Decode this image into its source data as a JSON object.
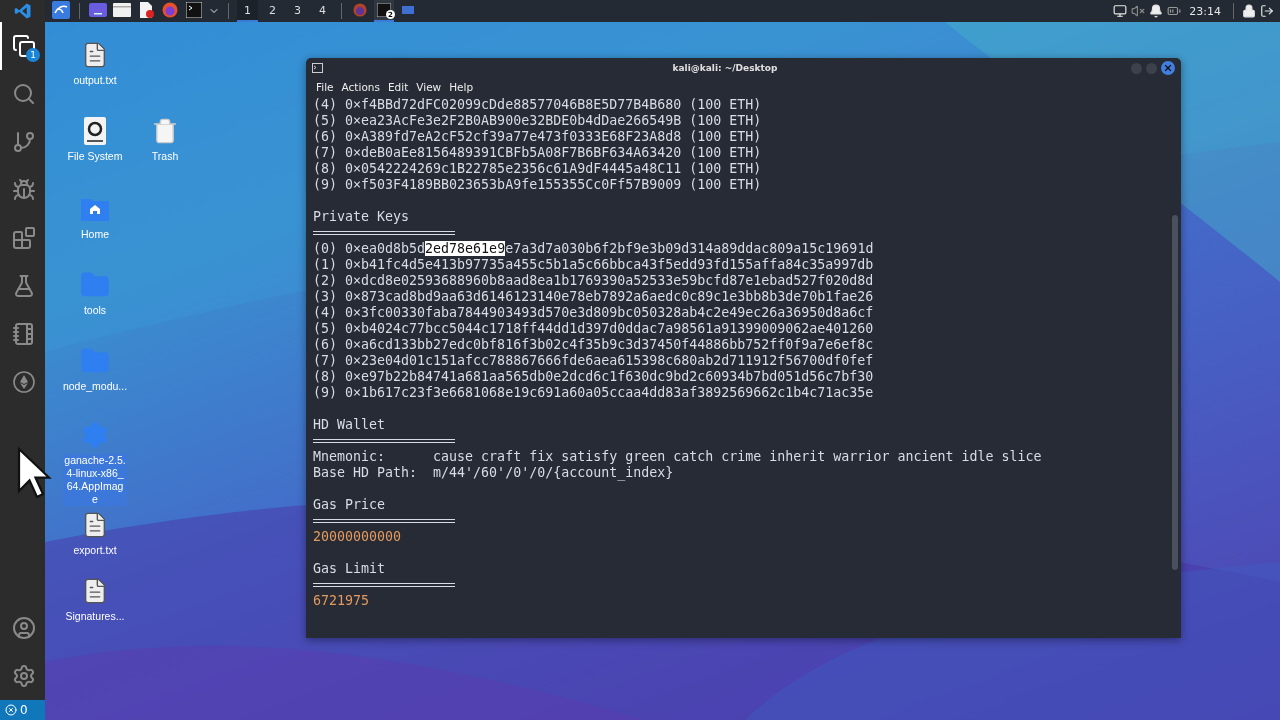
{
  "editor_sidebar": {
    "items": [
      {
        "kind": "files",
        "selected": true,
        "badge": "1"
      },
      {
        "kind": "search",
        "selected": false
      },
      {
        "kind": "source-control",
        "selected": false
      },
      {
        "kind": "run-debug",
        "selected": false
      },
      {
        "kind": "extensions",
        "selected": false
      },
      {
        "kind": "testing",
        "selected": false
      },
      {
        "kind": "notebook",
        "selected": false
      },
      {
        "kind": "ethereum",
        "selected": false
      }
    ],
    "bottom_items": [
      {
        "kind": "account"
      },
      {
        "kind": "settings"
      }
    ],
    "status_bar": {
      "errors": "0"
    }
  },
  "top_panel": {
    "workspaces": [
      {
        "label": "1",
        "selected": true
      },
      {
        "label": "2",
        "selected": false
      },
      {
        "label": "3",
        "selected": false
      },
      {
        "label": "4",
        "selected": false
      }
    ],
    "task_badge": "2",
    "clock": "23:14"
  },
  "desktop_icons": [
    {
      "label": "output.txt",
      "kind": "text-file",
      "selected": false
    },
    {
      "label": "File System",
      "kind": "drive",
      "selected": false
    },
    {
      "label": "Trash",
      "kind": "trash",
      "selected": false
    },
    {
      "label": "Home",
      "kind": "home-folder",
      "selected": false
    },
    {
      "label": "tools",
      "kind": "folder",
      "selected": false
    },
    {
      "label": "node_modu...",
      "kind": "folder",
      "selected": false
    },
    {
      "label": "ganache-2.5.4-linux-x86_64.AppImage",
      "kind": "app",
      "selected": true
    },
    {
      "label": "export.txt",
      "kind": "text-file",
      "selected": false
    },
    {
      "label": "Signatures...",
      "kind": "text-file",
      "selected": false
    }
  ],
  "terminal": {
    "title": "kali@kali: ~/Desktop",
    "menu": [
      "File",
      "Actions",
      "Edit",
      "View",
      "Help"
    ],
    "account_lines": [
      "(4) 0×f4BBd72dFC02099cDde88577046B8E5D77B4B680 (100 ETH)",
      "(5) 0×ea23AcFe3e2F2B0AB900e32BDE0b4dDae266549B (100 ETH)",
      "(6) 0×A389fd7eA2cF52cf39a77e473f0333E68F23A8d8 (100 ETH)",
      "(7) 0×deB0aEe8156489391CBFb5A08F7B6BF634A63420 (100 ETH)",
      "(8) 0×0542224269c1B22785e2356c61A9dF4445a48C11 (100 ETH)",
      "(9) 0×f503F4189BB023653bA9fe155355Cc0Ff57B9009 (100 ETH)"
    ],
    "sections": [
      {
        "heading": "Private Keys",
        "kind": "lines",
        "lines": [
          {
            "before": "(0) 0×ea0d8b5d",
            "highlight": "2ed78e61e9",
            "after": "e7a3d7a030b6f2bf9e3b09d314a89ddac809a15c19691d"
          },
          {
            "text": "(1) 0×b41fc4d5e413b97735a455c5b1a5c66bbca43f5edd93fd155affa84c35a997db"
          },
          {
            "text": "(2) 0×dcd8e02593688960b8aad8ea1b1769390a52533e59bcfd87e1ebad527f020d8d"
          },
          {
            "text": "(3) 0×873cad8bd9aa63d6146123140e78eb7892a6aedc0c89c1e3bb8b3de70b1fae26"
          },
          {
            "text": "(4) 0×3fc00330faba7844903493d570e3d809bc050328ab4c2e49ec26a36950d8a6cf"
          },
          {
            "text": "(5) 0×b4024c77bcc5044c1718ff44dd1d397d0ddac7a98561a91399009062ae401260"
          },
          {
            "text": "(6) 0×a6cd133bb27edc0bf816f3b02c4f35b9c3d37450f44886bb752ff0f9a7e6ef8c"
          },
          {
            "text": "(7) 0×23e04d01c151afcc788867666fde6aea615398c680ab2d711912f56700df0fef"
          },
          {
            "text": "(8) 0×e97b22b84741a681aa565db0e2dcd6c1f630dc9bd2c60934b7bd051d56c7bf30"
          },
          {
            "text": "(9) 0×1b617c23f3e6681068e19c691a60a05ccaa4dd83af3892569662c1b4c71ac35e"
          }
        ]
      },
      {
        "heading": "HD Wallet",
        "kind": "fields",
        "fields": [
          {
            "label": "Mnemonic:",
            "value": "cause craft fix satisfy green catch crime inherit warrior ancient idle slice"
          },
          {
            "label": "Base HD Path:",
            "value": "m/44'/60'/0'/0/{account_index}"
          }
        ]
      },
      {
        "heading": "Gas Price",
        "kind": "value",
        "value": "20000000000"
      },
      {
        "heading": "Gas Limit",
        "kind": "value",
        "value": "6721975"
      }
    ]
  }
}
